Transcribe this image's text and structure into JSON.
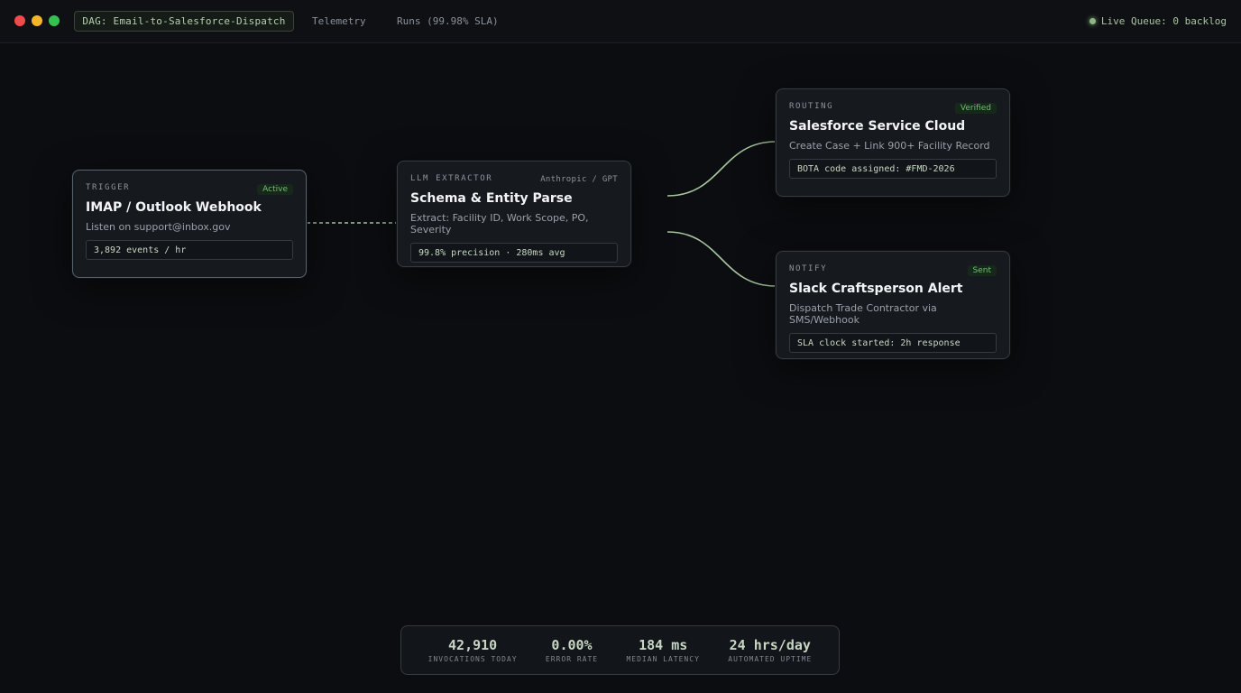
{
  "window": {
    "controls": [
      "close",
      "minimize",
      "maximize"
    ]
  },
  "tabs": {
    "active": "DAG: Email-to-Salesforce-Dispatch",
    "telemetry": "Telemetry",
    "runs": "Runs (99.98% SLA)"
  },
  "live_status": "Live Queue: 0 backlog",
  "nodes": [
    {
      "kind": "TRIGGER",
      "badge": "Active",
      "title": "IMAP / Outlook Webhook",
      "sub": "Listen on support@inbox.gov",
      "metric": "3,892 events / hr"
    },
    {
      "kind": "LLM EXTRACTOR",
      "vendor": "Anthropic / GPT",
      "title": "Schema & Entity Parse",
      "sub": "Extract: Facility ID, Work Scope, PO, Severity",
      "metric": "99.8% precision · 280ms avg"
    },
    {
      "kind": "ROUTING",
      "badge": "Verified",
      "title": "Salesforce Service Cloud",
      "sub": "Create Case + Link 900+ Facility Record",
      "metric": "BOTA code assigned: #FMD-2026"
    },
    {
      "kind": "NOTIFY",
      "badge": "Sent",
      "title": "Slack Craftsperson Alert",
      "sub": "Dispatch Trade Contractor via SMS/Webhook",
      "metric": "SLA clock started: 2h response"
    }
  ],
  "stats": [
    {
      "value": "42,910",
      "label": "INVOCATIONS TODAY"
    },
    {
      "value": "0.00%",
      "label": "ERROR RATE"
    },
    {
      "value": "184 ms",
      "label": "MEDIAN LATENCY"
    },
    {
      "value": "24 hrs/day",
      "label": "AUTOMATED UPTIME"
    }
  ],
  "colors": {
    "accent": "#a9c6a0",
    "background": "#0b0d10",
    "node_bg": "#16191e",
    "badge_green": "#6fbf6f"
  }
}
